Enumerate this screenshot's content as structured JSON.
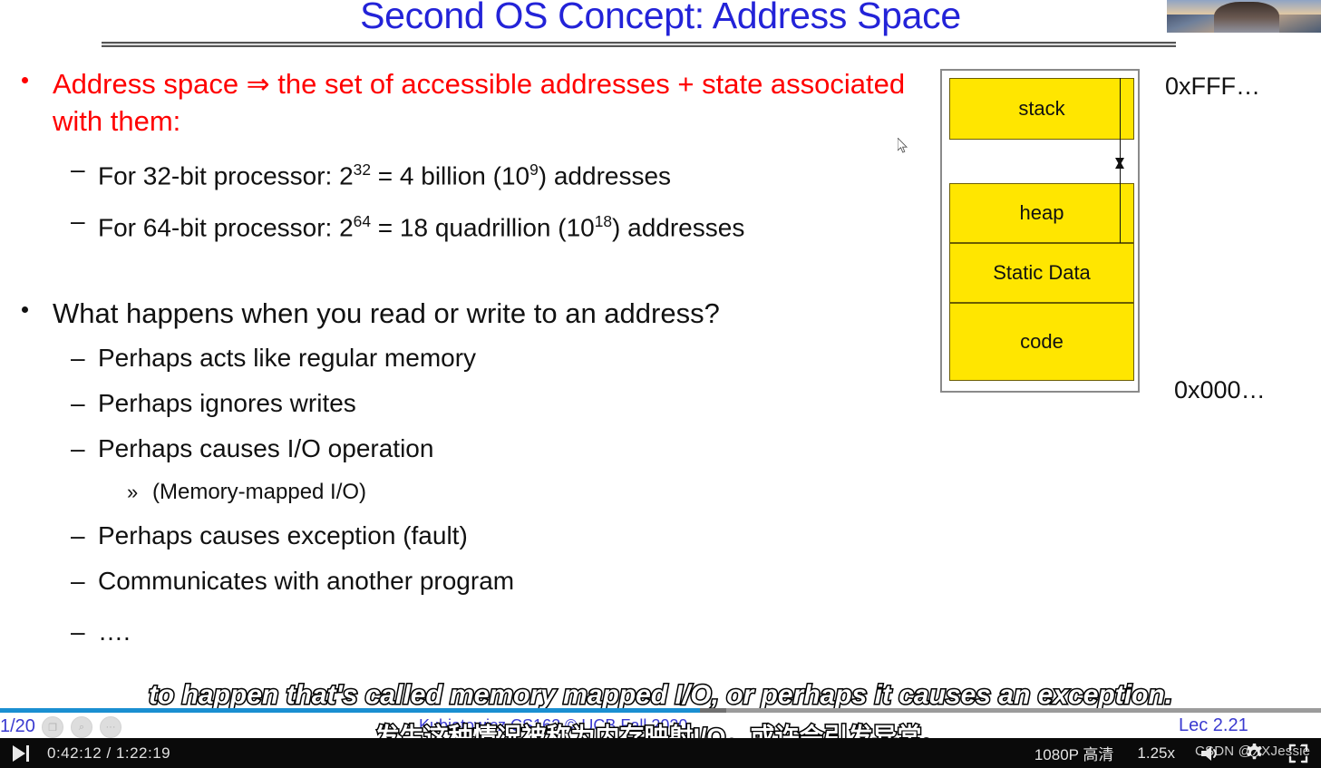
{
  "slide": {
    "title": "Second OS Concept: Address Space",
    "bullets": [
      {
        "level": 1,
        "color": "#ff0000",
        "text": "Address space ⇒ the set of accessible addresses + state associated with them:"
      },
      {
        "level": 2,
        "text_pre": "For 32-bit processor: 2",
        "sup1": "32",
        "text_mid": " = 4 billion (10",
        "sup2": "9",
        "text_post": ")  addresses"
      },
      {
        "level": 2,
        "text_pre": "For 64-bit processor: 2",
        "sup1": "64",
        "text_mid": " = 18 quadrillion (10",
        "sup2": "18",
        "text_post": ") addresses"
      },
      {
        "level": 1,
        "text": "What happens when you read or write to an address?"
      },
      {
        "level": 2,
        "text": "Perhaps acts like regular memory"
      },
      {
        "level": 2,
        "text": "Perhaps ignores writes"
      },
      {
        "level": 2,
        "text": "Perhaps causes I/O operation"
      },
      {
        "level": 3,
        "text": "(Memory-mapped I/O)"
      },
      {
        "level": 2,
        "text": "Perhaps causes exception (fault)"
      },
      {
        "level": 2,
        "text": "Communicates with another program"
      },
      {
        "level": 2,
        "text": "…."
      }
    ],
    "bullet_marker": "–",
    "sub_bullet_marker": "»",
    "memory_diagram": {
      "segments": [
        {
          "name": "stack",
          "label": "stack"
        },
        {
          "name": "heap",
          "label": "heap"
        },
        {
          "name": "static-data",
          "label": "Static Data"
        },
        {
          "name": "code",
          "label": "code"
        }
      ],
      "segment_color": "#ffe600",
      "address_high": "0xFFF…",
      "address_low": "0x000…",
      "stack_growth": "down",
      "heap_growth": "up"
    },
    "footer": {
      "page": "1/20",
      "credit": "Kubiatowicz CS162 © UCB Fall 2020",
      "lecture": "Lec 2.21",
      "accent_color": "#3a3ad0"
    },
    "mini_buttons": [
      {
        "name": "screenshot-icon",
        "glyph": "❐"
      },
      {
        "name": "zoom-icon",
        "glyph": "⌕"
      },
      {
        "name": "more-icon",
        "glyph": "···"
      }
    ]
  },
  "subtitles": {
    "english": "to happen that's called memory mapped I/O, or perhaps it causes an exception.",
    "chinese": "发生这种情况被称为内存映射I/O，或许会引发异常。"
  },
  "player": {
    "play_button_state": "play",
    "current_time": "0:42:12",
    "separator": "/",
    "total_time": "1:22:19",
    "time_display": "0:42:12  /  1:22:19",
    "quality": "1080P 高清",
    "speed": "1.25x",
    "progress_percent": 53,
    "progress_color": "#1a8fd1",
    "icons": {
      "volume": "volume-icon",
      "settings": "gear-icon",
      "fullscreen": "fullscreen-icon"
    }
  },
  "watermark": {
    "csdn": "CSDN @XXJessie",
    "logo": "bilibili-tv-logo"
  }
}
